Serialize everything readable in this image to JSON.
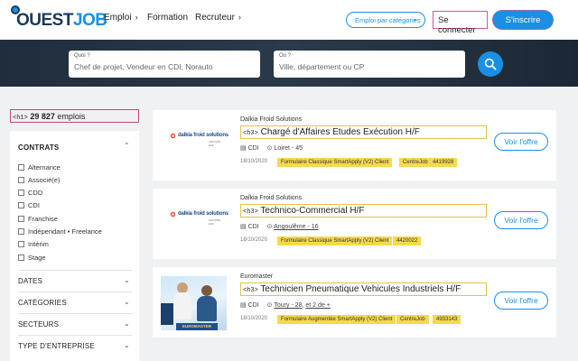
{
  "header": {
    "logo_prefix": "OUEST",
    "logo_suffix": "JOB",
    "nav": [
      {
        "label": "Emploi",
        "chevron": true
      },
      {
        "label": "Formation",
        "chevron": false
      },
      {
        "label": "Recruteur",
        "chevron": true
      }
    ],
    "category_button": "Emploi par catégories",
    "connect": "Se connecter",
    "signup": "S'inscrire"
  },
  "search": {
    "what_label": "Quoi ?",
    "what_placeholder": "Chef de projet, Vendeur en CDI, Norauto",
    "where_label": "Où ?",
    "where_placeholder": "Ville, département ou CP"
  },
  "results": {
    "tag": "<h1>",
    "count": "29 827",
    "unit": "emplois"
  },
  "filters": {
    "contrats_title": "CONTRATS",
    "contrats": [
      "Alternance",
      "Associé(e)",
      "CDD",
      "CDI",
      "Franchise",
      "Indépendant • Freelance",
      "Intérim",
      "Stage"
    ],
    "sections": [
      "DATES",
      "CATÉGORIES",
      "SECTEURS",
      "TYPE D'ENTREPRISE"
    ]
  },
  "jobs": [
    {
      "company": "Dalkia Froid Solutions",
      "logo_text": "dalkia froid solutions",
      "logo_sub": "GROUPE EDF",
      "tag": "<h3>",
      "title": "Chargé d'Affaires Etudes Exécution H/F",
      "contract": "CDI",
      "location": "Loiret - 45",
      "location_extra": "",
      "date": "18/10/2020",
      "badges": [
        "Formulaire Classique SmartApply (V2) Client",
        "CentreJob",
        "4419928"
      ],
      "button": "Voir l'offre"
    },
    {
      "company": "Dalkia Froid Solutions",
      "logo_text": "dalkia froid solutions",
      "logo_sub": "GROUPE EDF",
      "tag": "<h3>",
      "title": "Technico-Commercial H/F",
      "contract": "CDI",
      "location": "Angoulême - 16",
      "location_extra": "",
      "date": "18/10/2020",
      "badges": [
        "Formulaire Classique SmartApply (V2) Client",
        "4420022"
      ],
      "button": "Voir l'offre"
    },
    {
      "company": "Euromaster",
      "logo_text": "EUROMASTER",
      "logo_sub": "",
      "tag": "<h3>",
      "title": "Technicien Pneumatique Vehicules Industriels H/F",
      "contract": "CDI",
      "location": "Toury - 28",
      "location_extra": "et 2 de +",
      "date": "18/10/2020",
      "badges": [
        "Formulaire Augmentée SmartApply (V2) Client",
        "CentreJob",
        "4933143"
      ],
      "button": "Voir l'offre"
    }
  ],
  "colors": {
    "accent": "#1a8fe3",
    "badge": "#f7d94c",
    "header_band": "#1f2d3d"
  }
}
